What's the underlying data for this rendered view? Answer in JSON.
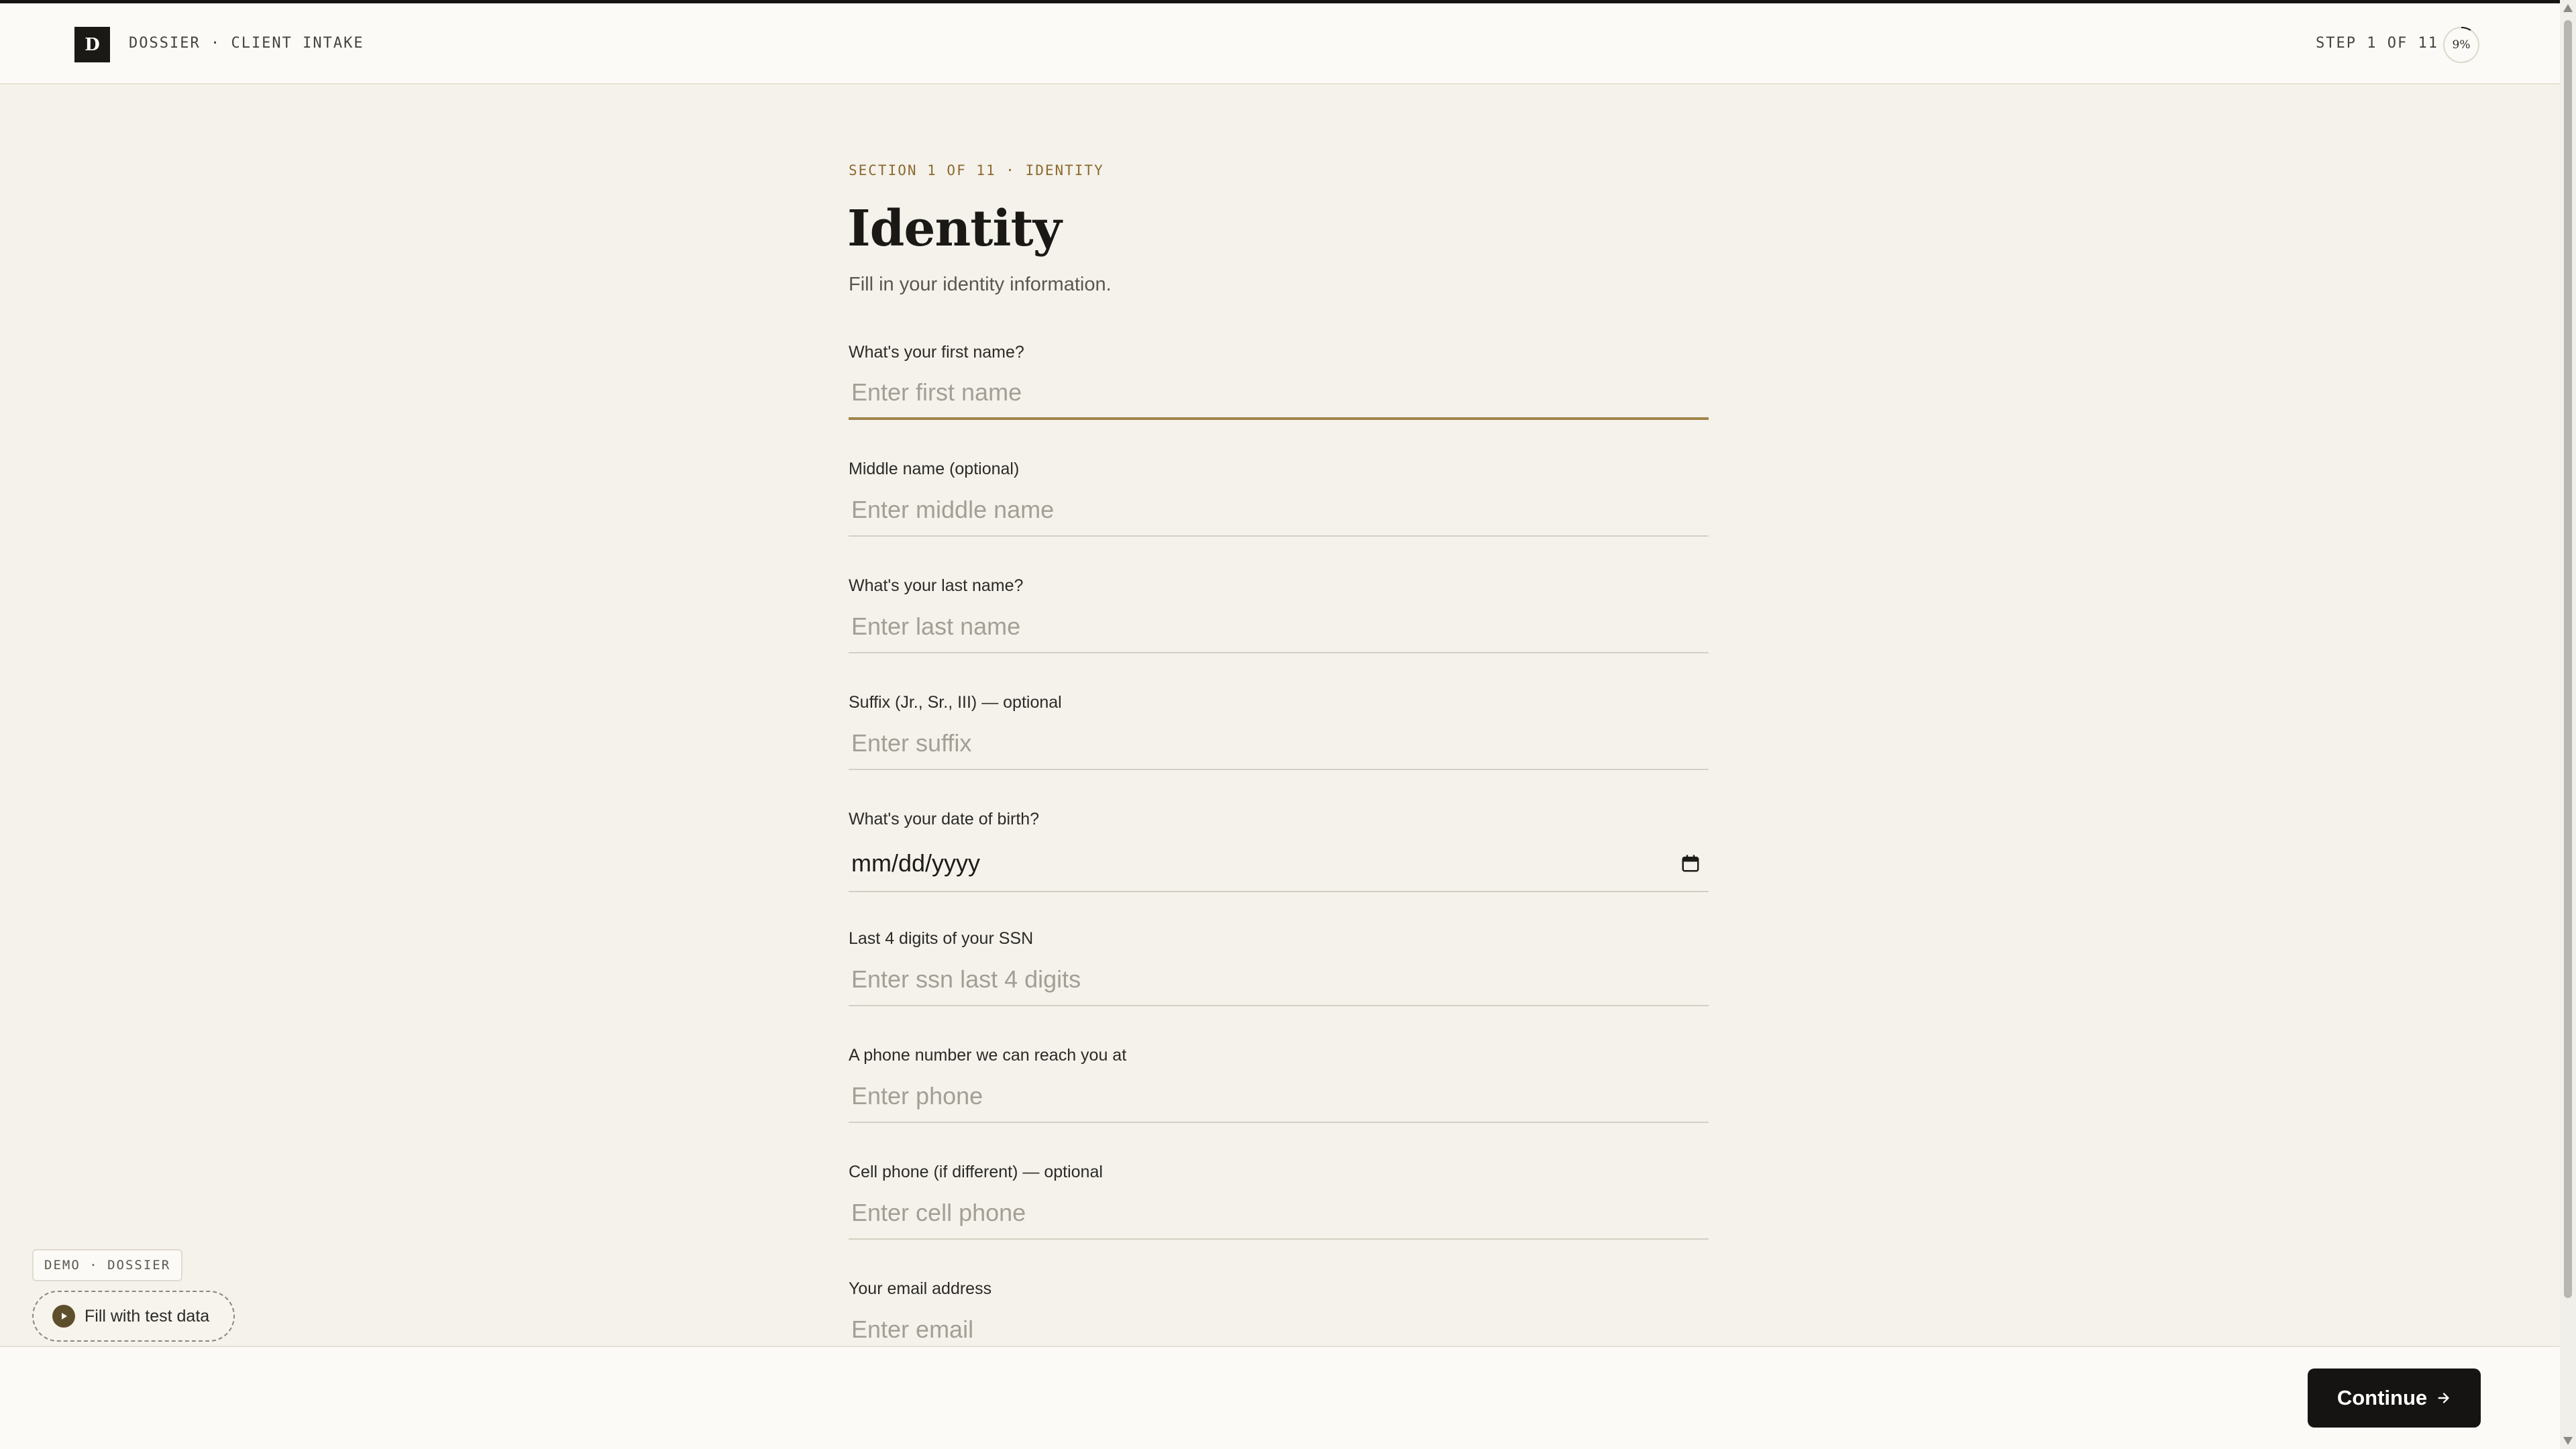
{
  "header": {
    "logo_letter": "D",
    "brand": "DOSSIER · CLIENT INTAKE",
    "step": "STEP 1 OF 11",
    "progress_label": "9%",
    "progress_fraction": 0.09
  },
  "section": {
    "kicker": "SECTION 1 OF 11 · IDENTITY",
    "title": "Identity",
    "subtitle": "Fill in your identity information."
  },
  "fields": [
    {
      "label": "What's your first name?",
      "placeholder": "Enter first name"
    },
    {
      "label": "Middle name (optional)",
      "placeholder": "Enter middle name"
    },
    {
      "label": "What's your last name?",
      "placeholder": "Enter last name"
    },
    {
      "label": "Suffix (Jr., Sr., III) — optional",
      "placeholder": "Enter suffix"
    },
    {
      "label": "What's your date of birth?",
      "value": "mm/dd/yyyy"
    },
    {
      "label": "Last 4 digits of your SSN",
      "placeholder": "Enter ssn last 4 digits"
    },
    {
      "label": "A phone number we can reach you at",
      "placeholder": "Enter phone"
    },
    {
      "label": "Cell phone (if different) — optional",
      "placeholder": "Enter cell phone"
    },
    {
      "label": "Your email address",
      "placeholder": "Enter email"
    }
  ],
  "demo": {
    "tag": "DEMO · DOSSIER",
    "fill_button": "Fill with test data"
  },
  "footer": {
    "continue_label": "Continue"
  },
  "icons": {
    "calendar": "calendar-icon",
    "arrow": "arrow-right-icon",
    "play": "play-icon"
  },
  "colors": {
    "accent": "#a0844a",
    "kicker": "#8c6a2e",
    "primary_button": "#151412",
    "background": "#f5f2ec"
  }
}
